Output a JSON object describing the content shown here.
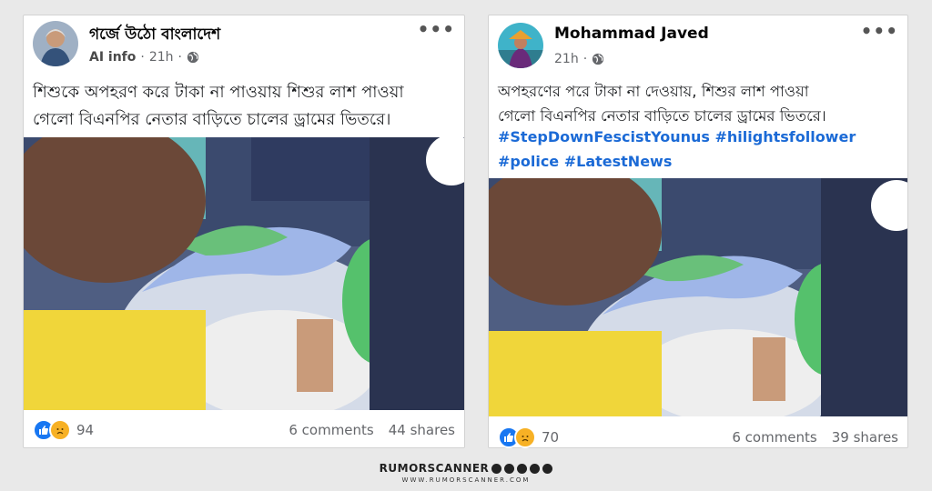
{
  "posts": [
    {
      "author": "গর্জে উঠো বাংলাদেশ",
      "ai_label": "AI info",
      "time": "21h",
      "text_line1": "শিশুকে অপহরণ করে টাকা না পাওয়ায় শিশুর লাশ পাওয়া",
      "text_line2": "গেলো বিএনপির নেতার বাড়িতে চালের ড্রামের ভিতরে।",
      "reaction_count": "94",
      "comments": "6 comments",
      "shares": "44 shares"
    },
    {
      "author": "Mohammad Javed",
      "time": "21h",
      "text_line1": "অপহরণের পরে টাকা না দেওয়ায়, শিশুর লাশ পাওয়া",
      "text_line2": "গেলো বিএনপির নেতার বাড়িতে চালের ড্রামের ভিতরে।",
      "hashtags_line1": "#StepDownFescistYounus #hilightsfollower",
      "hashtags_line2": "#police #LatestNews",
      "reaction_count": "70",
      "comments": "6 comments",
      "shares": "39 shares"
    }
  ],
  "icons": {
    "more": "more-options-icon",
    "globe": "globe-icon",
    "like": "like-reaction-icon",
    "sad": "sad-reaction-icon"
  },
  "colors": {
    "hashtag": "#1b6ad6",
    "like": "#1877f2",
    "sad": "#f7b125"
  },
  "watermark": {
    "brand": "RUMORSCANNER",
    "url": "WWW.RUMORSCANNER.COM"
  }
}
